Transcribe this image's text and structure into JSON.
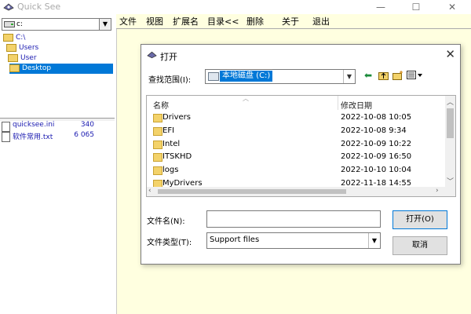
{
  "app": {
    "title": "Quick See",
    "minimize_symbol": "—",
    "maximize_symbol": "☐",
    "close_symbol": "✕"
  },
  "left_panel": {
    "drive_value": "c:",
    "tree": [
      {
        "label": "C:\\",
        "selected": false
      },
      {
        "label": "Users",
        "selected": false
      },
      {
        "label": "User",
        "selected": false
      },
      {
        "label": "Desktop",
        "selected": true
      }
    ],
    "files": [
      {
        "name": "quicksee.ini",
        "size": "340"
      },
      {
        "name": "软件常用.txt",
        "size": "6 065"
      }
    ]
  },
  "menu": {
    "items": [
      "文件",
      "视图",
      "扩展名",
      "目录<<",
      "删除",
      "关于",
      "退出"
    ]
  },
  "dialog": {
    "title": "打开",
    "close_symbol": "✕",
    "lookin_label": "查找范围(I):",
    "lookin_value": "本地磁盘 (C:)",
    "columns": {
      "name": "名称",
      "date": "修改日期"
    },
    "rows": [
      {
        "name": "Drivers",
        "date": "2022-10-08 10:05"
      },
      {
        "name": "EFI",
        "date": "2022-10-08 9:34"
      },
      {
        "name": "Intel",
        "date": "2022-10-09 10:22"
      },
      {
        "name": "ITSKHD",
        "date": "2022-10-09 16:50"
      },
      {
        "name": "logs",
        "date": "2022-10-10 10:04"
      },
      {
        "name": "MyDrivers",
        "date": "2022-11-18 14:55"
      }
    ],
    "filename_label": "文件名(N):",
    "filename_value": "",
    "filetype_label": "文件类型(T):",
    "filetype_value": "Support files",
    "open_button": "打开(O)",
    "cancel_button": "取消"
  }
}
